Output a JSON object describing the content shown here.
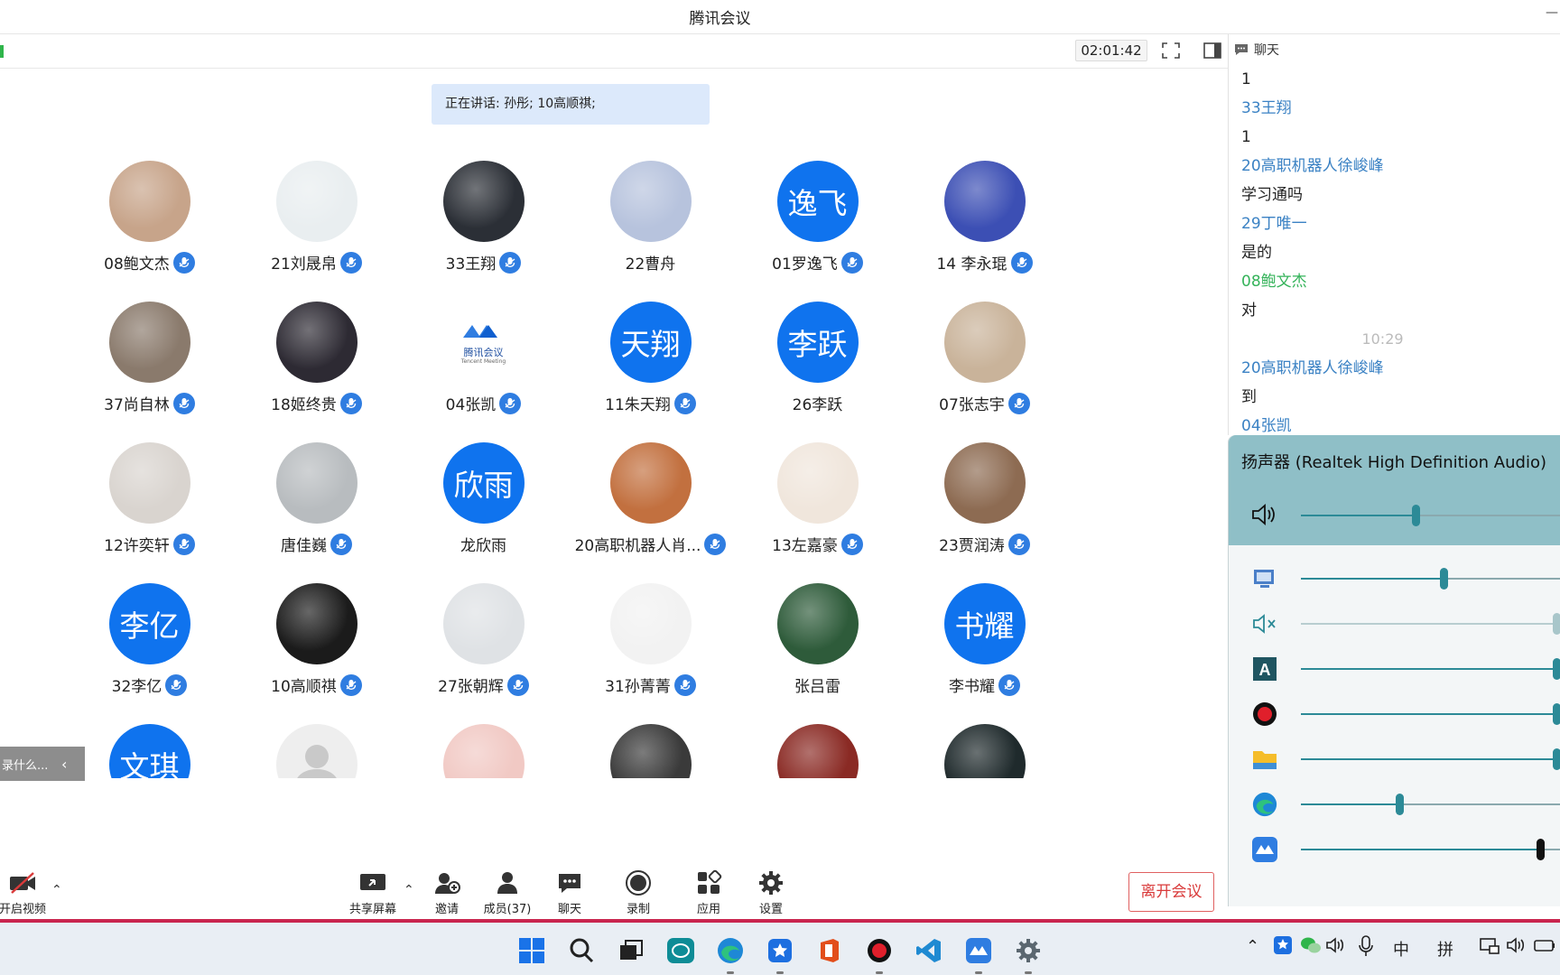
{
  "window": {
    "title": "腾讯会议"
  },
  "toolbar": {
    "timer": "02:01:42"
  },
  "speaking": {
    "text": "正在讲话: 孙彤; 10高顺祺;"
  },
  "participants": [
    {
      "name": "08鲍文杰",
      "avatar": "photo",
      "color": "#c7a48a",
      "mic": true
    },
    {
      "name": "21刘晟帛",
      "avatar": "photo",
      "color": "#e9eef0",
      "mic": true
    },
    {
      "name": "33王翔",
      "avatar": "photo",
      "color": "#2b2f36",
      "mic": true
    },
    {
      "name": "22曹舟",
      "avatar": "photo",
      "color": "#b7c3dd",
      "mic": false
    },
    {
      "name": "01罗逸飞",
      "avatar": "text",
      "initials": "逸飞",
      "mic": true
    },
    {
      "name": "14 李永琨",
      "avatar": "photo",
      "color": "#3c4fb4",
      "mic": true
    },
    {
      "name": "37尚自林",
      "avatar": "photo",
      "color": "#8a7a6c",
      "mic": true
    },
    {
      "name": "18姬终贵",
      "avatar": "photo",
      "color": "#2d2a33",
      "mic": true
    },
    {
      "name": "04张凯",
      "avatar": "logo",
      "logo_text": "腾讯会议",
      "logo_sub": "Tencent Meeting",
      "mic": true
    },
    {
      "name": "11朱天翔",
      "avatar": "text",
      "initials": "天翔",
      "mic": true
    },
    {
      "name": "26李跃",
      "avatar": "text",
      "initials": "李跃",
      "mic": false
    },
    {
      "name": "07张志宇",
      "avatar": "photo",
      "color": "#c9b39a",
      "mic": true
    },
    {
      "name": "12许奕轩",
      "avatar": "photo",
      "color": "#d9d4cf",
      "mic": true
    },
    {
      "name": "唐佳巍",
      "avatar": "photo",
      "color": "#b8bcbf",
      "mic": true
    },
    {
      "name": "龙欣雨",
      "avatar": "text",
      "initials": "欣雨",
      "mic": false
    },
    {
      "name": "20高职机器人肖...",
      "avatar": "photo",
      "color": "#c2703f",
      "mic": true
    },
    {
      "name": "13左嘉豪",
      "avatar": "photo",
      "color": "#f0e6dc",
      "mic": true
    },
    {
      "name": "23贾润涛",
      "avatar": "photo",
      "color": "#8d6b52",
      "mic": true
    },
    {
      "name": "32李亿",
      "avatar": "text",
      "initials": "李亿",
      "mic": true
    },
    {
      "name": "10高顺祺",
      "avatar": "photo",
      "color": "#1b1b1b",
      "mic": true
    },
    {
      "name": "27张朝辉",
      "avatar": "photo",
      "color": "#dfe2e5",
      "mic": true
    },
    {
      "name": "31孙菁菁",
      "avatar": "photo",
      "color": "#f2f2f2",
      "mic": true
    },
    {
      "name": "张吕雷",
      "avatar": "photo",
      "color": "#2e5b3a",
      "mic": false
    },
    {
      "name": "李书耀",
      "avatar": "text",
      "initials": "书耀",
      "mic": true
    },
    {
      "name": "",
      "avatar": "text",
      "initials": "文琪",
      "mic": false
    },
    {
      "name": "",
      "avatar": "default",
      "mic": false
    },
    {
      "name": "",
      "avatar": "photo",
      "color": "#f1c9c4",
      "mic": false
    },
    {
      "name": "",
      "avatar": "photo",
      "color": "#3a3a3a",
      "mic": false
    },
    {
      "name": "",
      "avatar": "photo",
      "color": "#8a2a24",
      "mic": false
    },
    {
      "name": "",
      "avatar": "photo",
      "color": "#1f2a2c",
      "mic": false
    }
  ],
  "side_pill": {
    "text": "录什么...",
    "arrow": "‹"
  },
  "controls": {
    "video": "开启视频",
    "share": "共享屏幕",
    "invite": "邀请",
    "members": "成员(37)",
    "chat": "聊天",
    "record": "录制",
    "apps": "应用",
    "settings": "设置",
    "leave": "离开会议"
  },
  "chat": {
    "title": "聊天",
    "messages": [
      {
        "text": "1",
        "type": "text"
      },
      {
        "text": "33王翔",
        "type": "name"
      },
      {
        "text": " 1",
        "type": "text"
      },
      {
        "text": "20高职机器人徐峻峰",
        "type": "name"
      },
      {
        "text": "学习通吗",
        "type": "text"
      },
      {
        "text": "29丁唯一",
        "type": "name"
      },
      {
        "text": "是的",
        "type": "text"
      },
      {
        "text": "08鲍文杰",
        "type": "name-green"
      },
      {
        "text": "对",
        "type": "text"
      },
      {
        "text": "10:29",
        "type": "time"
      },
      {
        "text": "20高职机器人徐峻峰",
        "type": "name"
      },
      {
        "text": "到",
        "type": "text"
      },
      {
        "text": "04张凯",
        "type": "name"
      }
    ]
  },
  "mixer": {
    "device": "扬声器 (Realtek High Definition Audio)",
    "master_level": 0.44,
    "apps": [
      {
        "icon": "system-sounds-icon",
        "level": 0.55
      },
      {
        "icon": "muted-speaker-icon",
        "level": 1.0,
        "muted": true
      },
      {
        "icon": "font-app-icon",
        "level": 1.0
      },
      {
        "icon": "recorder-icon",
        "level": 1.0
      },
      {
        "icon": "file-explorer-icon",
        "level": 1.0
      },
      {
        "icon": "edge-icon",
        "level": 0.38
      },
      {
        "icon": "tencent-meeting-icon",
        "level": 0.92
      }
    ]
  },
  "tray": {
    "ime_cn": "中",
    "ime_pinyin": "拼"
  }
}
